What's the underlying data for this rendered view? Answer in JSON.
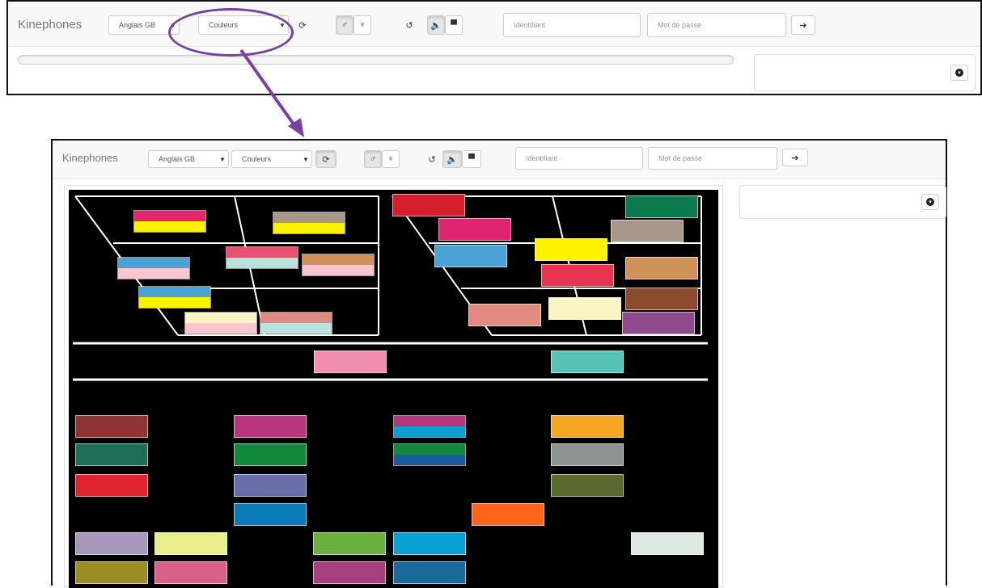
{
  "app": {
    "brand": "Kinephones",
    "language_select": "Anglais GB",
    "mode_select": "Couleurs",
    "identifier_placeholder": "Identifiant",
    "password_placeholder": "Mot de passe"
  },
  "icons": {
    "refresh": "refresh-icon",
    "person_male": "male-icon",
    "person_female": "female-icon",
    "undo": "undo-icon",
    "sound": "volume-icon",
    "screen": "display-icon",
    "login": "login-icon",
    "chevron": "chevron-down-icon"
  },
  "annotation": {
    "color": "#7a3fa0"
  },
  "swatch_colors": {
    "vowels_left": [
      [
        "#e8246f",
        "#fff200"
      ],
      [
        "#a8988a",
        "#fff200"
      ],
      [
        "#e8506f",
        "#b9e3dc"
      ],
      [
        "#4aa3d4",
        "#f7c6cf"
      ],
      [
        "#d0925a",
        "#f7c6cf"
      ],
      [
        "#4aa3d4",
        "#fff200"
      ],
      [
        "#fbf5c4",
        "#f7c6cf"
      ],
      [
        "#e08a80",
        "#b9e3dc"
      ]
    ],
    "vowels_right": [
      "#d61f2c",
      "#e0246f",
      "#0c7a4e",
      "#a8988a",
      "#4aa3d4",
      "#fff200",
      "#e8344f",
      "#d0925a",
      "#e08a80",
      "#fbf5c4",
      "#8a4a2e",
      "#8e4a8a"
    ],
    "middle": [
      "#f28fb0",
      "#55c2b4"
    ],
    "consonants": [
      "#8e3432",
      "#1e6e5a",
      "#e0232f",
      "#a797bb",
      "#9a8d26",
      "#b8347c",
      "#12883c",
      "#6a6ea8",
      "#0a7ab8",
      "#e9ee8a",
      "#d8608a",
      "#69b040",
      "#a8407e",
      "#0aa0d4",
      "#1a6a9a",
      "#f5a623",
      "#8e9290",
      "#5a6a2e",
      "#ff6418",
      "#dbe9e0"
    ],
    "consonants_dual": [
      [
        "#b8347c",
        "#0aa0d4"
      ],
      [
        "#12883c",
        "#1a5aa0"
      ]
    ]
  }
}
